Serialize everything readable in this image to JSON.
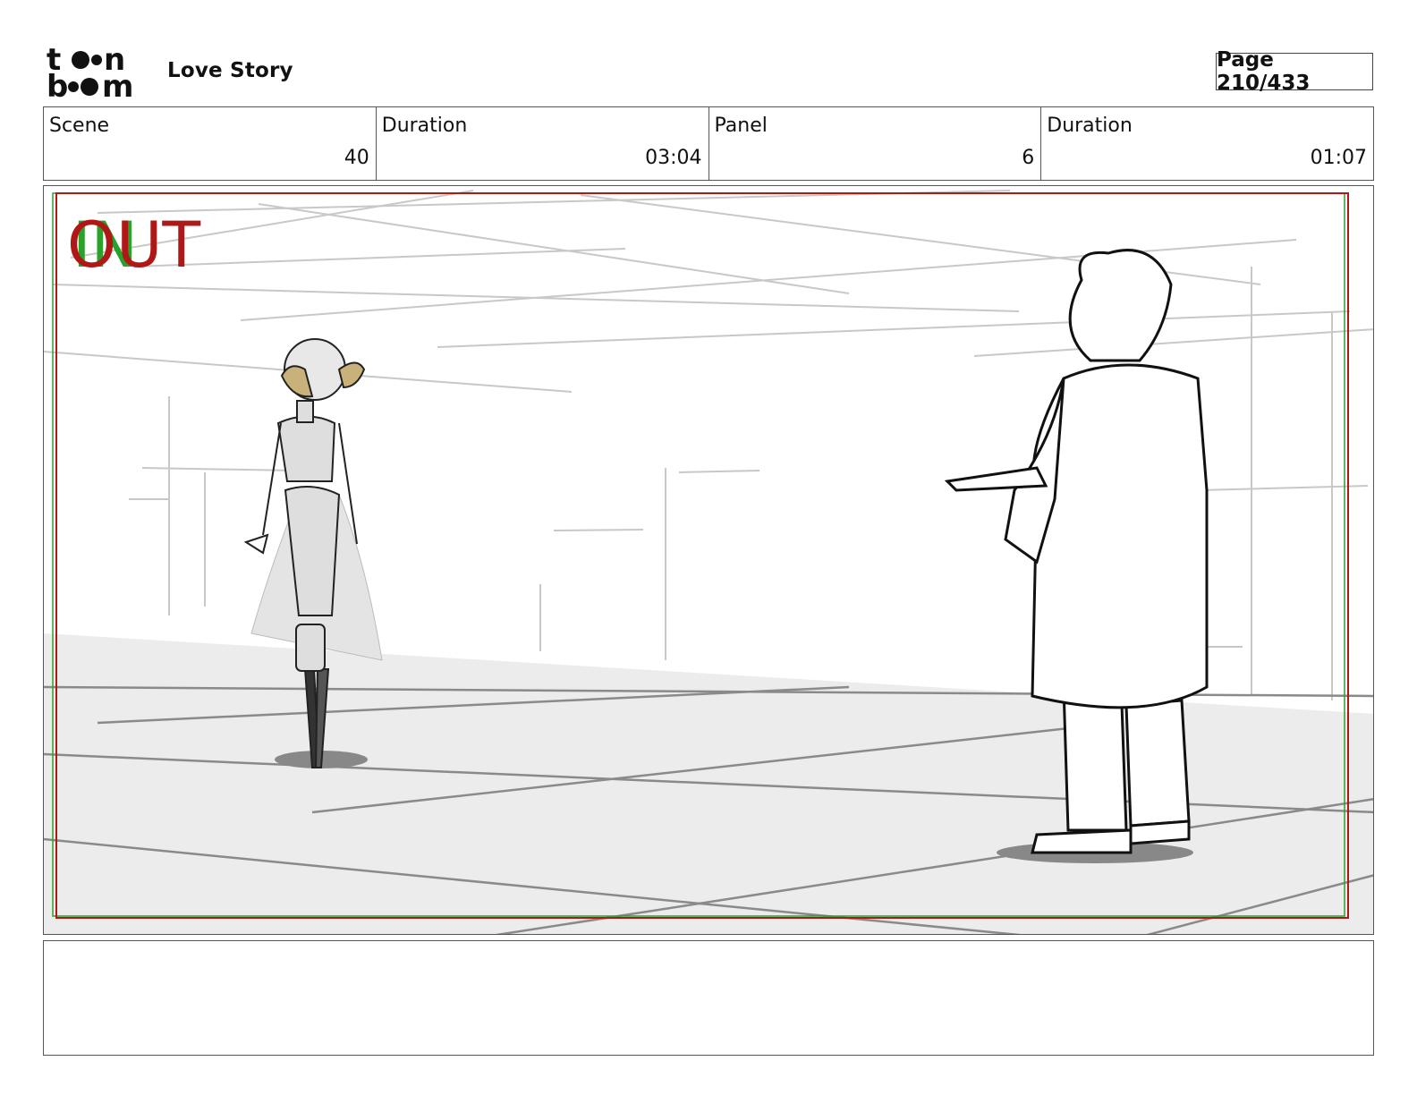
{
  "header": {
    "logo_text": "toon boom",
    "title": "Love Story",
    "page_label": "Page 210/433"
  },
  "info": [
    {
      "label": "Scene",
      "value": "40"
    },
    {
      "label": "Duration",
      "value": "03:04"
    },
    {
      "label": "Panel",
      "value": "6"
    },
    {
      "label": "Duration",
      "value": "01:07"
    }
  ],
  "panel": {
    "in_marker": "IN",
    "out_marker": "OUT",
    "in_color": "#2aa12a",
    "out_color": "#b01818"
  },
  "notes": {
    "text": ""
  }
}
